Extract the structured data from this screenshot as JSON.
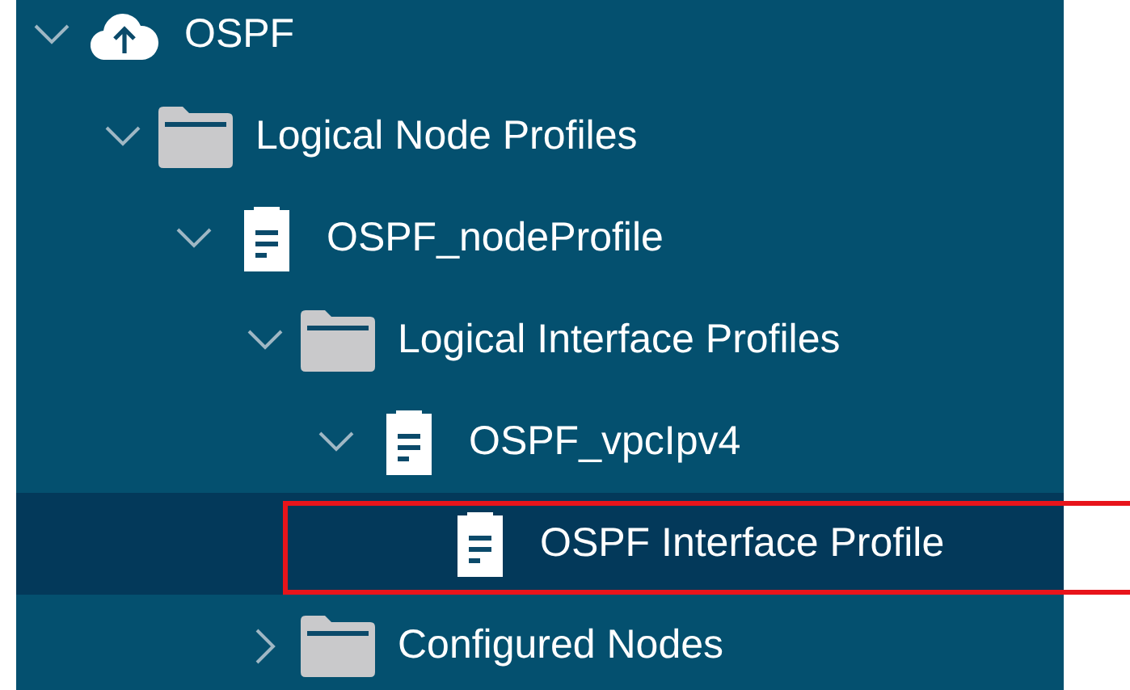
{
  "tree": [
    {
      "label": "OSPF",
      "kind": "cloud",
      "expanded": true,
      "selected": false,
      "children": [
        {
          "label": "Logical Node Profiles",
          "kind": "folder",
          "expanded": true,
          "selected": false,
          "children": [
            {
              "label": "OSPF_nodeProfile",
              "kind": "document",
              "expanded": true,
              "selected": false,
              "children": [
                {
                  "label": "Logical Interface Profiles",
                  "kind": "folder",
                  "expanded": true,
                  "selected": false,
                  "children": [
                    {
                      "label": "OSPF_vpcIpv4",
                      "kind": "document",
                      "expanded": true,
                      "selected": false,
                      "children": [
                        {
                          "label": "OSPF Interface Profile",
                          "kind": "document",
                          "selected": true
                        }
                      ]
                    }
                  ]
                },
                {
                  "label": "Configured Nodes",
                  "kind": "folder",
                  "expanded": false,
                  "selected": false
                }
              ]
            }
          ]
        }
      ]
    }
  ]
}
